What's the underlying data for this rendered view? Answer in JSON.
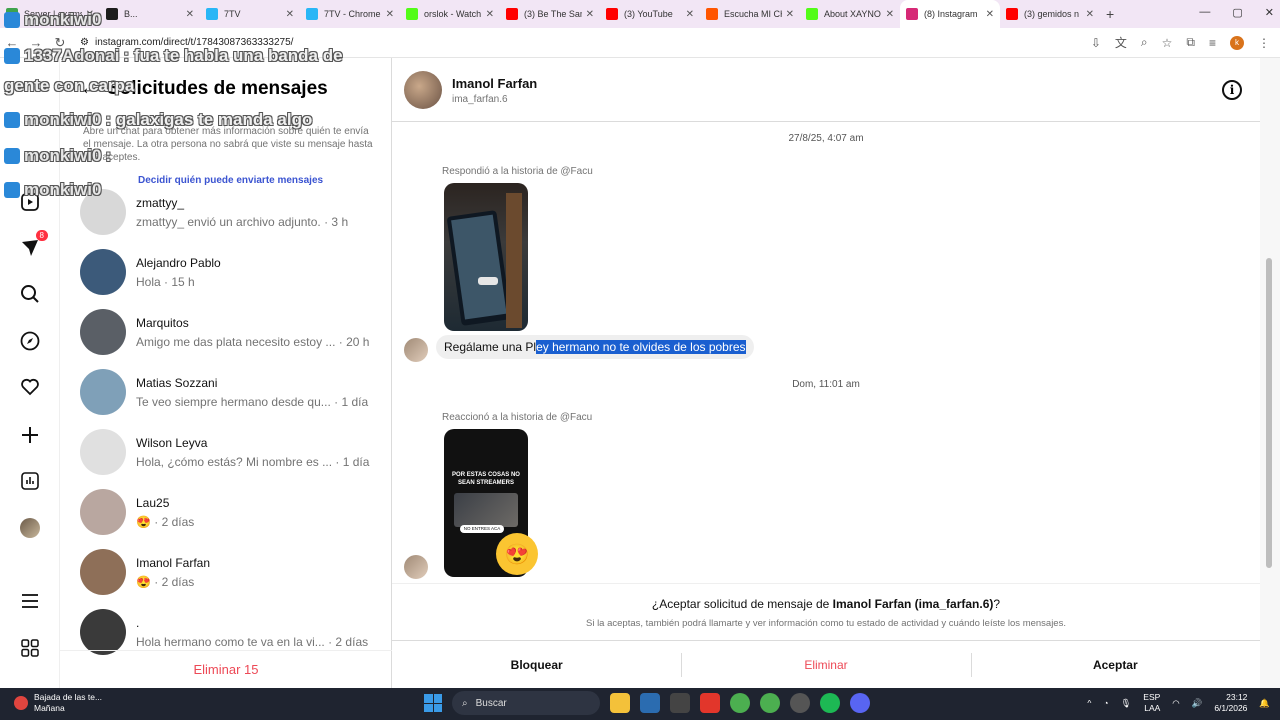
{
  "browser": {
    "tabs": [
      {
        "title": "Server | exams",
        "color": "#3fa34d",
        "active": false
      },
      {
        "title": "B...",
        "color": "#1d1d1d",
        "active": false
      },
      {
        "title": "7TV",
        "color": "#29b6f6",
        "active": false
      },
      {
        "title": "7TV - Chrome",
        "color": "#29b6f6",
        "active": false
      },
      {
        "title": "orslok - Watch",
        "color": "#53fc18",
        "active": false
      },
      {
        "title": "(3) Be The Sam",
        "color": "#ff0000",
        "active": false
      },
      {
        "title": "(3) YouTube",
        "color": "#ff0000",
        "active": false
      },
      {
        "title": "Escucha MI CH",
        "color": "#ff5500",
        "active": false
      },
      {
        "title": "About XAYNO",
        "color": "#53fc18",
        "active": false
      },
      {
        "title": "(8) Instagram",
        "color": "#d62976",
        "active": true
      },
      {
        "title": "(3) gemidos n",
        "color": "#ff0000",
        "active": false
      }
    ],
    "url": "instagram.com/direct/t/17843087363333275/"
  },
  "overlay": [
    {
      "user": "monkiwi0",
      "text": ""
    },
    {
      "user": "1337Adonai",
      "text": ": fua te habla una banda de"
    },
    {
      "user": "",
      "text": "gente con carpa"
    },
    {
      "user": "monkiwi0",
      "text": ": galaxigas te manda algo"
    },
    {
      "user": "monkiwi0",
      "text": ":"
    },
    {
      "user": "monkiwi0",
      "text": ""
    }
  ],
  "rail": {
    "notifications_badge": "8"
  },
  "requests": {
    "title": "Solicitudes de mensajes",
    "description": "Abre un chat para obtener más información sobre quién te envía el mensaje. La otra persona no sabrá que viste su mensaje hasta que aceptes.",
    "who_can_message": "Decidir quién puede enviarte mensajes",
    "items": [
      {
        "name": "zmattyy_",
        "preview": "zmattyy_ envió un archivo adjunto. · 3 h",
        "avatar": "#d8d8d8"
      },
      {
        "name": "Alejandro Pablo",
        "preview": "Hola · 15 h",
        "avatar": "#3c5a7a"
      },
      {
        "name": "Marquitos",
        "preview": "Amigo me das plata necesito estoy ... · 20 h",
        "avatar": "#5a5f66"
      },
      {
        "name": "Matias Sozzani",
        "preview": "Te veo siempre hermano desde qu... · 1 día",
        "avatar": "#7fa0b8"
      },
      {
        "name": "Wilson Leyva",
        "preview": "Hola, ¿cómo estás? Mi nombre es ... · 1 día",
        "avatar": "#e0e0e0"
      },
      {
        "name": "Lau25",
        "preview": "😍 · 2 días",
        "avatar": "#b9a7a0"
      },
      {
        "name": "Imanol Farfan",
        "preview": "😍 · 2 días",
        "avatar": "#8e6f58"
      },
      {
        "name": ".",
        "preview": "Hola hermano como te va en la vi... · 2 días",
        "avatar": "#3a3a3a"
      }
    ],
    "delete_all": "Eliminar 15"
  },
  "chat": {
    "name": "Imanol Farfan",
    "handle": "ima_farfan.6",
    "timestamp1": "27/8/25, 4:07 am",
    "reply_note1": "Respondió a la historia de @Facu",
    "message_before_selection": "Regálame una Pl",
    "message_selected": "ey hermano  no te olvides de los pobres",
    "timestamp2": "Dom, 11:01 am",
    "reply_note2": "Reaccionó a la historia de @Facu",
    "story2_caption": "POR ESTAS COSAS NO SEAN STREAMERS",
    "story2_button": "NO ENTRES ACA",
    "reaction": "😍",
    "accept_question_prefix": "¿Aceptar solicitud de mensaje de ",
    "accept_question_name": "Imanol Farfan (ima_farfan.6)",
    "accept_question_suffix": "?",
    "accept_subtext": "Si la aceptas, también podrá llamarte y ver información como tu estado de actividad y cuándo leíste los mensajes.",
    "actions": {
      "block": "Bloquear",
      "delete": "Eliminar",
      "accept": "Aceptar"
    }
  },
  "taskbar": {
    "weather_line1": "Bajada de las te...",
    "weather_line2": "Mañana",
    "search_placeholder": "Buscar",
    "lang_line1": "ESP",
    "lang_line2": "LAA",
    "time": "23:12",
    "date": "6/1/2026"
  }
}
